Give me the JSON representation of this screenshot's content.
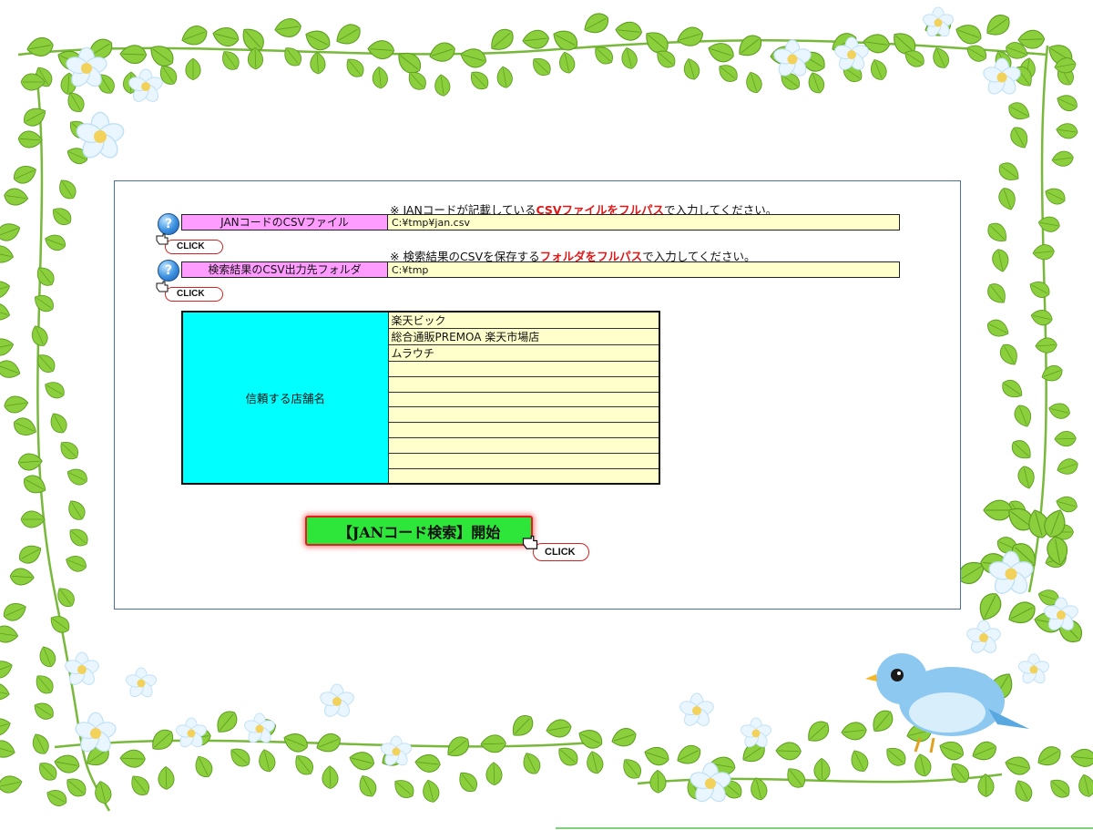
{
  "form": {
    "jan_note_prefix": "※ JANコードが記載している",
    "jan_note_emphasis": "CSVファイルをフルパス",
    "jan_note_suffix": "で入力してください。",
    "jan_label": "JANコードのCSVファイル",
    "jan_value": "C:¥tmp¥jan.csv",
    "out_note_prefix": "※ 検索結果のCSVを保存する",
    "out_note_emphasis": "フォルダをフルパス",
    "out_note_suffix": "で入力してください。",
    "out_label": "検索結果のCSV出力先フォルダ",
    "out_value": "C:¥tmp",
    "help_glyph": "?",
    "click_label": "CLICK"
  },
  "shops": {
    "label": "信頼する店舗名",
    "rows": [
      "楽天ビック",
      "総合通販PREMOA 楽天市場店",
      "ムラウチ",
      "",
      "",
      "",
      "",
      "",
      "",
      "",
      ""
    ]
  },
  "start_button": {
    "label": "【JANコード検索】開始"
  },
  "icons": {
    "help": "question-mark-icon",
    "pointer": "pointing-hand-icon",
    "bird": "bluebird-illustration",
    "frame": "leafy-vine-frame"
  },
  "colors": {
    "label_pink": "#ff9cff",
    "input_yellow": "#ffffcc",
    "shop_label_cyan": "#00ffff",
    "start_green": "#2ee63a",
    "emphasis_red": "#e01818",
    "panel_border": "#4a6fa5"
  }
}
